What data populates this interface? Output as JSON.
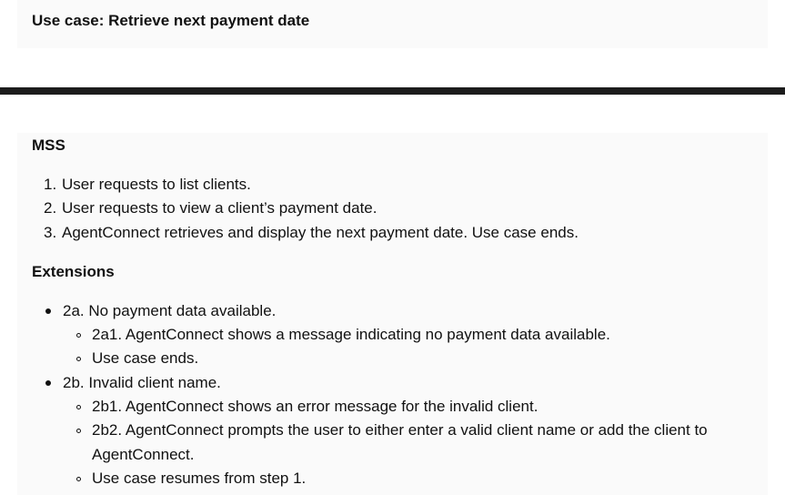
{
  "title": "Use case: Retrieve next payment date",
  "mss": {
    "heading": "MSS",
    "steps": [
      {
        "num": "1.",
        "text": "User requests to list clients."
      },
      {
        "num": "2.",
        "text": "User requests to view a client’s payment date."
      },
      {
        "num": "3.",
        "text": "AgentConnect retrieves and display the next payment date. Use case ends."
      }
    ]
  },
  "extensions": {
    "heading": "Extensions",
    "items": [
      {
        "text": "2a. No payment data available.",
        "subitems": [
          "2a1. AgentConnect shows a message indicating no payment data available.",
          "Use case ends."
        ]
      },
      {
        "text": "2b. Invalid client name.",
        "subitems": [
          "2b1. AgentConnect shows an error message for the invalid client.",
          "2b2. AgentConnect prompts the user to either enter a valid client name or add the client to",
          "AgentConnect.",
          "Use case resumes from step 1."
        ]
      }
    ]
  }
}
